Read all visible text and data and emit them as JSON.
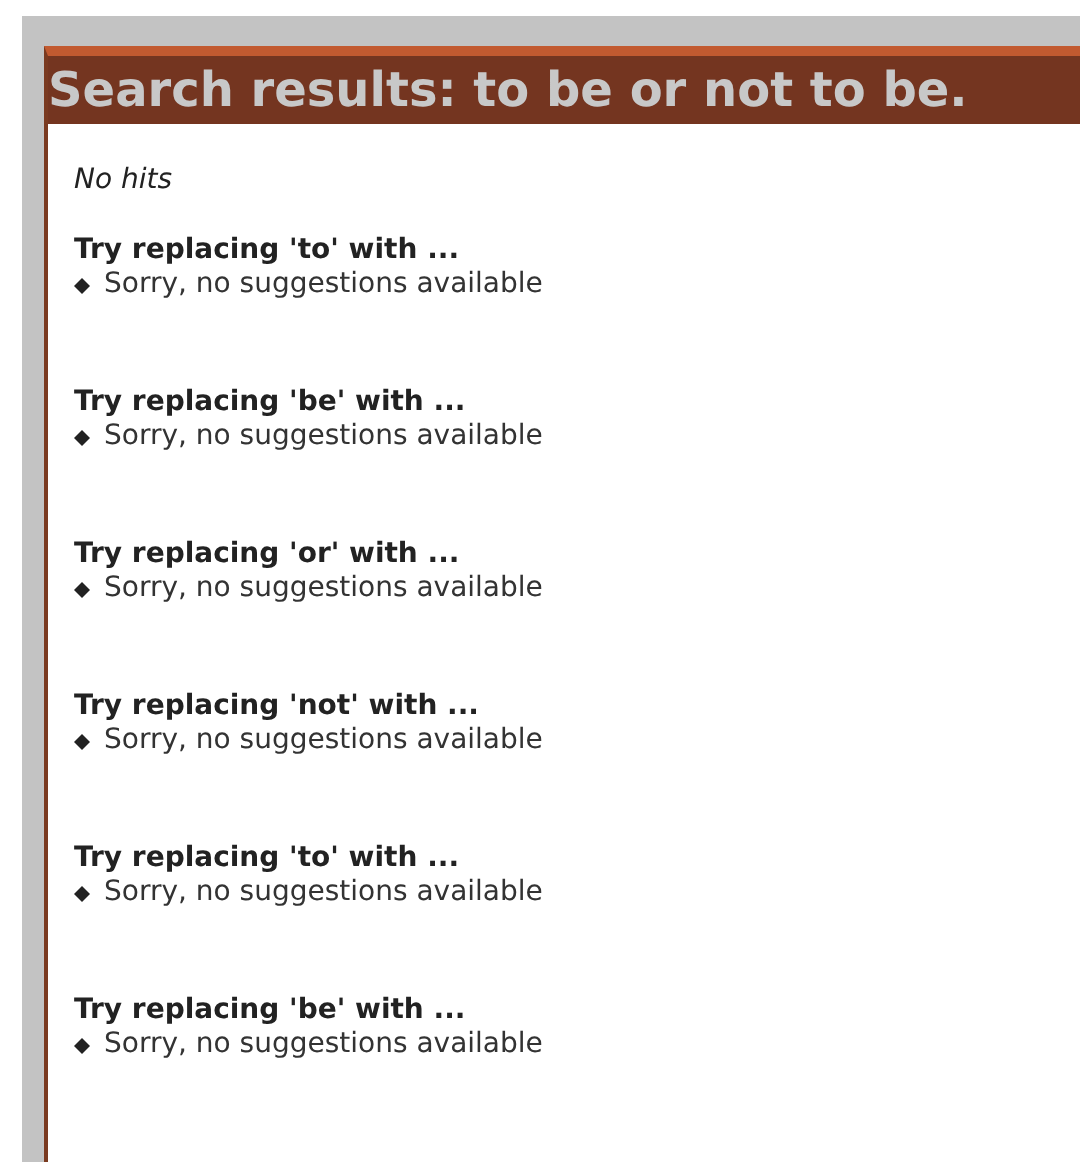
{
  "title": "Search results: to be or not to be.",
  "status": "No hits",
  "sections": [
    {
      "heading": "Try replacing 'to' with ...",
      "suggestions": [
        "Sorry, no suggestions available"
      ]
    },
    {
      "heading": "Try replacing 'be' with ...",
      "suggestions": [
        "Sorry, no suggestions available"
      ]
    },
    {
      "heading": "Try replacing 'or' with ...",
      "suggestions": [
        "Sorry, no suggestions available"
      ]
    },
    {
      "heading": "Try replacing 'not' with ...",
      "suggestions": [
        "Sorry, no suggestions available"
      ]
    },
    {
      "heading": "Try replacing 'to' with ...",
      "suggestions": [
        "Sorry, no suggestions available"
      ]
    },
    {
      "heading": "Try replacing 'be' with ...",
      "suggestions": [
        "Sorry, no suggestions available"
      ]
    }
  ]
}
